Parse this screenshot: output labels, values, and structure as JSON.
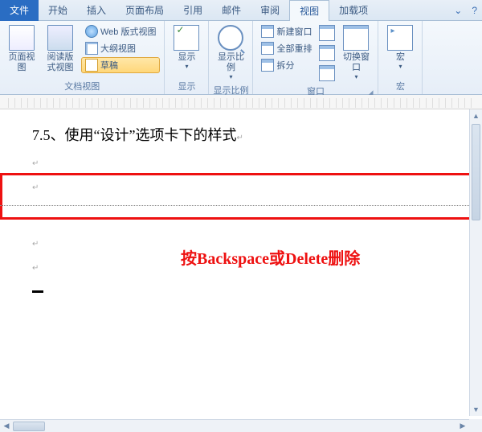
{
  "tabs": {
    "file": "文件",
    "home": "开始",
    "insert": "插入",
    "layout": "页面布局",
    "references": "引用",
    "mail": "邮件",
    "review": "审阅",
    "view": "视图",
    "addins": "加载项"
  },
  "ribbon": {
    "views": {
      "label": "文档视图",
      "pageView": "页面视图",
      "readView": "阅读版式视图",
      "webView": "Web 版式视图",
      "outlineView": "大纲视图",
      "draft": "草稿"
    },
    "show": {
      "label": "显示",
      "btn": "显示"
    },
    "zoom": {
      "label": "显示比例",
      "btn": "显示比例"
    },
    "window": {
      "label": "窗口",
      "newWindow": "新建窗口",
      "arrangeAll": "全部重排",
      "split": "拆分",
      "switch": "切换窗口"
    },
    "macros": {
      "label": "宏",
      "btn": "宏"
    }
  },
  "document": {
    "heading": "7.5、使用“设计”选项卡下的样式",
    "hint": "按Backspace或Delete删除"
  }
}
